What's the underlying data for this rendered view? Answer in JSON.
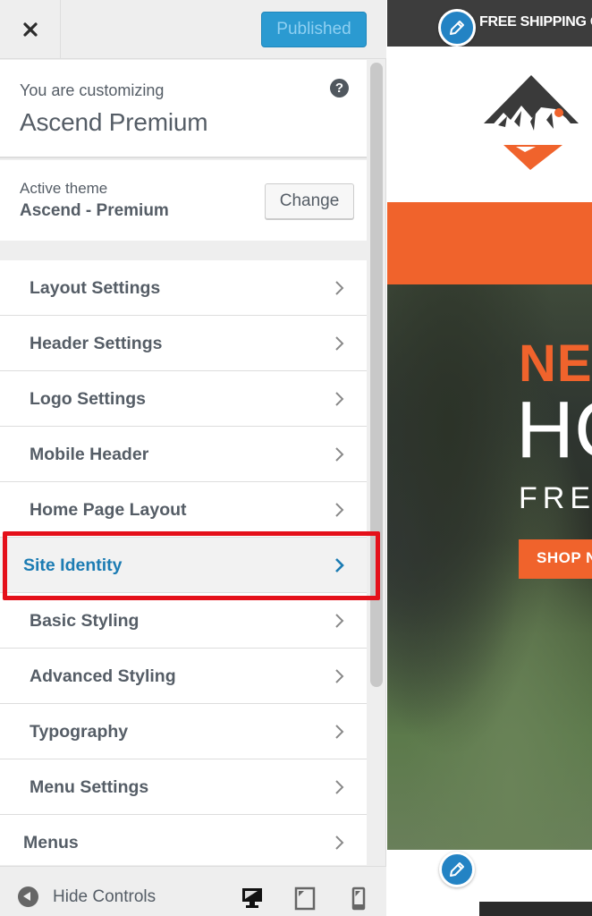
{
  "header": {
    "close_label": "Close",
    "publish_label": "Published"
  },
  "info": {
    "customizing_label": "You are customizing",
    "site_title": "Ascend Premium",
    "help_icon": "?"
  },
  "theme": {
    "active_label": "Active theme",
    "active_name": "Ascend - Premium",
    "change_label": "Change"
  },
  "panels": [
    {
      "label": "Layout Settings"
    },
    {
      "label": "Header Settings"
    },
    {
      "label": "Logo Settings"
    },
    {
      "label": "Mobile Header"
    },
    {
      "label": "Home Page Layout"
    },
    {
      "label": "Site Identity",
      "selected": true
    },
    {
      "label": "Basic Styling"
    },
    {
      "label": "Advanced Styling"
    },
    {
      "label": "Typography"
    },
    {
      "label": "Menu Settings"
    },
    {
      "label": "Menus"
    }
  ],
  "footer": {
    "hide_controls_label": "Hide Controls",
    "devices": [
      "desktop",
      "tablet",
      "mobile"
    ],
    "active_device": "desktop"
  },
  "preview": {
    "topbar_text": "FREE SHIPPING O",
    "hero_line1": "NE",
    "hero_line2": "HC",
    "hero_line3": "FRE",
    "shop_button": "SHOP N"
  },
  "colors": {
    "accent": "#2b9ad1",
    "selected_text": "#1c7cb3",
    "highlight": "#e4101a",
    "brand_orange": "#f0632c"
  }
}
